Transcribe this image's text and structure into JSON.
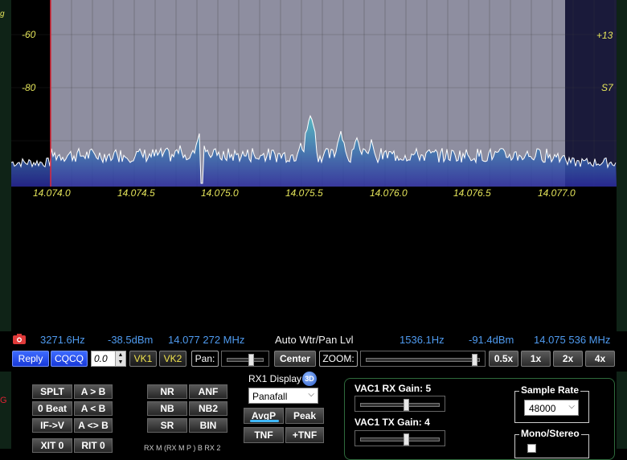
{
  "panadapter": {
    "db_labels_left": [
      "-60",
      "-80"
    ],
    "db_labels_right": [
      "+13",
      "S7"
    ],
    "freq_labels": [
      "14.074.0",
      "14.074.5",
      "14.075.0",
      "14.075.5",
      "14.076.0",
      "14.076.5",
      "14.077.0"
    ],
    "colors": {
      "passband": "#8e8ea0",
      "trace": "#ffffff",
      "fill_low": "#2a2a9c",
      "fill_high": "#4fc0c8",
      "cursor": "#e0283a",
      "grid": "#3a3a3a",
      "label": "#e5e55a"
    }
  },
  "status": {
    "cursor_offset": "3271.6Hz",
    "cursor_level": "-38.5dBm",
    "cursor_freq": "14.077 272 MHz",
    "mode": "Auto Wtr/Pan Lvl",
    "peak_offset": "1536.1Hz",
    "peak_level": "-91.4dBm",
    "peak_freq": "14.075 536 MHz"
  },
  "bar": {
    "reply": "Reply",
    "cqcq": "CQCQ",
    "spin_value": "0.0",
    "vk1": "VK1",
    "vk2": "VK2",
    "pan": "Pan:",
    "center": "Center",
    "zoom": "ZOOM:",
    "z05": "0.5x",
    "z1": "1x",
    "z2": "2x",
    "z4": "4x"
  },
  "lower": {
    "splt": "SPLT",
    "a_to_b": "A > B",
    "zero_beat": "0 Beat",
    "a_lt_b": "A < B",
    "if_v": "IF->V",
    "a_swap_b": "A <> B",
    "xit": "XIT",
    "xit_val": "0",
    "rit": "RIT",
    "rit_val": "0",
    "nr": "NR",
    "anf": "ANF",
    "nb": "NB",
    "nb2": "NB2",
    "sr": "SR",
    "bin": "BIN",
    "rx1_display": "RX1 Display",
    "display_mode": "Panafall",
    "avgp": "AvgP",
    "peak": "Peak",
    "tnf": "TNF",
    "plus_tnf": "+TNF",
    "bottom_text": "RX M    (RX M  P  ) B   RX 2",
    "vac1_rx": "VAC1 RX Gain: 5",
    "vac1_tx": "VAC1 TX Gain: 4",
    "sample_rate_label": "Sample Rate",
    "sample_rate": "48000",
    "mono_stereo": "Mono/Stereo"
  }
}
